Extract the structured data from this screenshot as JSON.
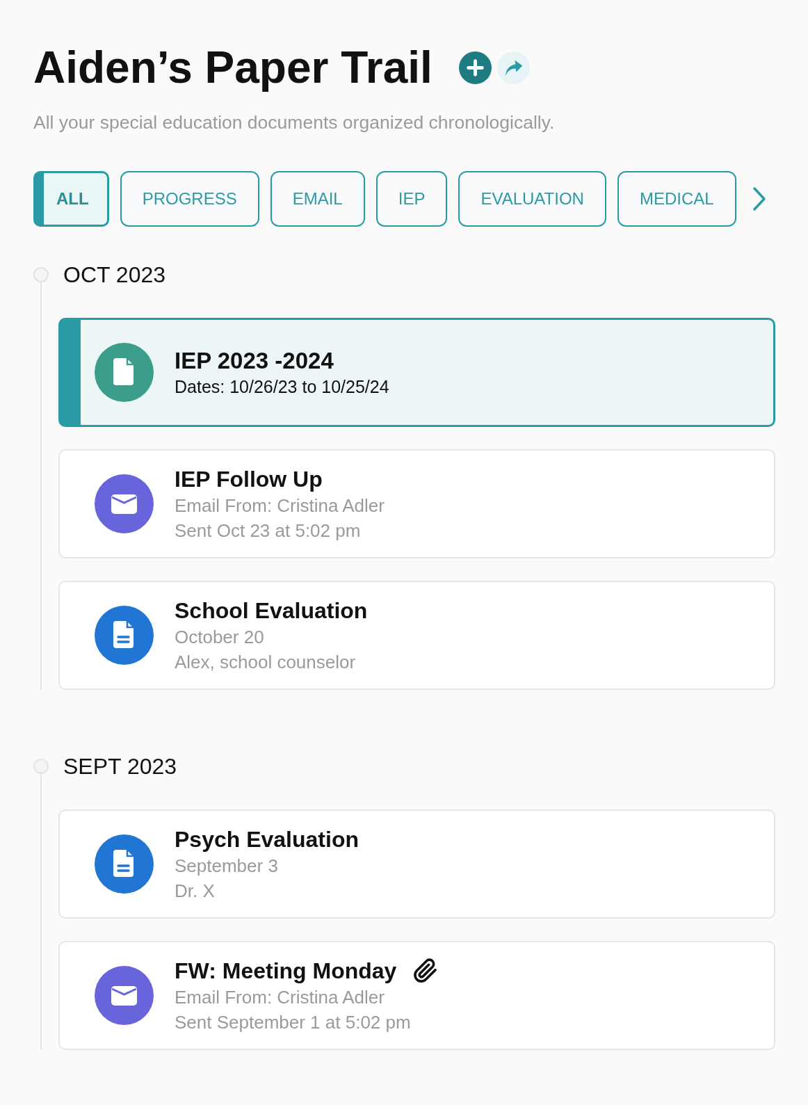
{
  "header": {
    "title": "Aiden’s Paper Trail",
    "subtitle": "All your special education documents organized chronologically."
  },
  "filters": [
    {
      "label": "ALL",
      "selected": true
    },
    {
      "label": "PROGRESS",
      "selected": false
    },
    {
      "label": "EMAIL",
      "selected": false
    },
    {
      "label": "IEP",
      "selected": false
    },
    {
      "label": "EVALUATION",
      "selected": false
    },
    {
      "label": "MEDICAL",
      "selected": false
    }
  ],
  "timeline": [
    {
      "month": "OCT 2023",
      "documents": [
        {
          "kind": "iep",
          "title": "IEP 2023 -2024",
          "lines": [
            "Dates: 10/26/23 to 10/25/24"
          ],
          "selected": true,
          "attachment": false
        },
        {
          "kind": "email",
          "title": "IEP Follow Up",
          "lines": [
            "Email From: Cristina Adler",
            "Sent Oct 23 at 5:02 pm"
          ],
          "selected": false,
          "attachment": false
        },
        {
          "kind": "evaluation",
          "title": "School Evaluation",
          "lines": [
            "October 20",
            "Alex, school counselor"
          ],
          "selected": false,
          "attachment": false
        }
      ]
    },
    {
      "month": "SEPT 2023",
      "documents": [
        {
          "kind": "evaluation",
          "title": "Psych Evaluation",
          "lines": [
            "September 3",
            "Dr. X"
          ],
          "selected": false,
          "attachment": false
        },
        {
          "kind": "email",
          "title": "FW: Meeting Monday",
          "lines": [
            "Email From: Cristina Adler",
            "Sent September 1 at 5:02 pm"
          ],
          "selected": false,
          "attachment": true
        }
      ]
    }
  ]
}
